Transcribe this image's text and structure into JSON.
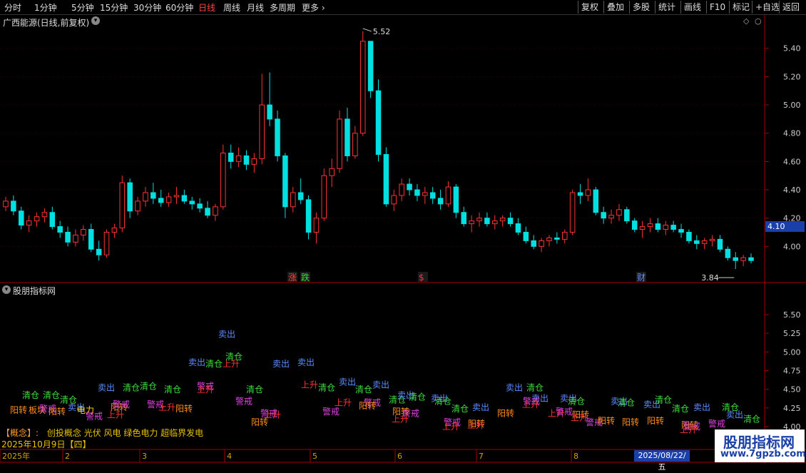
{
  "toolbar": {
    "periods": [
      "分时",
      "1分钟",
      "5分钟",
      "15分钟",
      "30分钟",
      "60分钟",
      "日线",
      "周线",
      "月线",
      "多周期",
      "更多"
    ],
    "buttons": [
      "复权",
      "叠加",
      "多股",
      "统计",
      "画线",
      "F10",
      "标记",
      "+自选",
      "返回"
    ]
  },
  "main_chart": {
    "title": "广西能源(日线,前复权)",
    "high_label": "5.52",
    "low_label": "3.84",
    "current_price": "4.10",
    "event_markers": [
      "涨",
      "跌",
      "$",
      "财"
    ]
  },
  "sub_chart": {
    "title": "股朋指标网",
    "concept_label": "【概念】:",
    "concept_text": "创投概念 光伏 风电 绿色电力 超临界发电",
    "date_text": "2025年10月9日【四】"
  },
  "timeline": {
    "labels": [
      "2025年",
      "2",
      "3",
      "4",
      "5",
      "6",
      "7",
      "8"
    ],
    "cursor_date": "2025/08/22/五"
  },
  "watermark": {
    "title": "股朋指标网",
    "url": "www.7gpzb.com"
  },
  "colors": {
    "up": "#ff3232",
    "down": "#00e0e0",
    "background": "#000000",
    "axis": "#a00000",
    "signal_sell": "#5b8cff",
    "signal_clear": "#3ddc3d",
    "signal_rise": "#ff3232",
    "signal_warn": "#e040e0",
    "signal_turn": "#ff8c1a"
  },
  "chart_data": [
    {
      "type": "candlestick",
      "title": "广西能源(日线,前复权)",
      "ylim": [
        3.8,
        5.55
      ],
      "yticks": [
        "5.40",
        "5.20",
        "5.00",
        "4.80",
        "4.60",
        "4.40",
        "4.20",
        "4.00"
      ],
      "x_labels": [
        "2025年",
        "2",
        "3",
        "4",
        "5",
        "6",
        "7",
        "8"
      ],
      "ohlc": [
        [
          4.28,
          4.35,
          4.25,
          4.32
        ],
        [
          4.32,
          4.36,
          4.22,
          4.25
        ],
        [
          4.25,
          4.28,
          4.12,
          4.15
        ],
        [
          4.15,
          4.22,
          4.1,
          4.18
        ],
        [
          4.18,
          4.24,
          4.14,
          4.21
        ],
        [
          4.21,
          4.27,
          4.17,
          4.24
        ],
        [
          4.24,
          4.28,
          4.12,
          4.14
        ],
        [
          4.14,
          4.18,
          4.06,
          4.1
        ],
        [
          4.1,
          4.14,
          4.0,
          4.03
        ],
        [
          4.03,
          4.12,
          4.0,
          4.08
        ],
        [
          4.08,
          4.15,
          4.04,
          4.12
        ],
        [
          4.12,
          4.16,
          3.96,
          3.98
        ],
        [
          3.98,
          4.04,
          3.9,
          3.94
        ],
        [
          3.94,
          4.12,
          3.92,
          4.1
        ],
        [
          4.1,
          4.16,
          4.06,
          4.13
        ],
        [
          4.13,
          4.5,
          4.1,
          4.45
        ],
        [
          4.45,
          4.48,
          4.2,
          4.25
        ],
        [
          4.25,
          4.35,
          4.22,
          4.32
        ],
        [
          4.32,
          4.42,
          4.28,
          4.38
        ],
        [
          4.38,
          4.45,
          4.3,
          4.34
        ],
        [
          4.34,
          4.4,
          4.28,
          4.31
        ],
        [
          4.31,
          4.38,
          4.28,
          4.35
        ],
        [
          4.35,
          4.42,
          4.3,
          4.36
        ],
        [
          4.36,
          4.4,
          4.3,
          4.32
        ],
        [
          4.32,
          4.35,
          4.26,
          4.3
        ],
        [
          4.3,
          4.34,
          4.24,
          4.27
        ],
        [
          4.27,
          4.32,
          4.2,
          4.22
        ],
        [
          4.22,
          4.3,
          4.18,
          4.28
        ],
        [
          4.28,
          4.72,
          4.26,
          4.66
        ],
        [
          4.66,
          4.72,
          4.55,
          4.6
        ],
        [
          4.6,
          4.7,
          4.56,
          4.64
        ],
        [
          4.64,
          4.68,
          4.54,
          4.58
        ],
        [
          4.58,
          4.66,
          4.52,
          4.62
        ],
        [
          4.62,
          5.22,
          4.58,
          5.0
        ],
        [
          5.0,
          5.23,
          4.85,
          4.9
        ],
        [
          4.9,
          4.96,
          4.6,
          4.64
        ],
        [
          4.64,
          4.66,
          4.2,
          4.28
        ],
        [
          4.28,
          4.42,
          4.24,
          4.38
        ],
        [
          4.38,
          4.48,
          4.3,
          4.33
        ],
        [
          4.33,
          4.36,
          4.05,
          4.1
        ],
        [
          4.1,
          4.24,
          4.02,
          4.2
        ],
        [
          4.2,
          4.55,
          4.18,
          4.5
        ],
        [
          4.5,
          4.62,
          4.42,
          4.55
        ],
        [
          4.55,
          4.96,
          4.52,
          4.9
        ],
        [
          4.9,
          4.98,
          4.6,
          4.64
        ],
        [
          4.64,
          4.85,
          4.62,
          4.8
        ],
        [
          4.8,
          5.52,
          4.78,
          5.45
        ],
        [
          5.45,
          5.42,
          5.05,
          5.1
        ],
        [
          5.1,
          5.18,
          4.6,
          4.65
        ],
        [
          4.65,
          4.7,
          4.28,
          4.3
        ],
        [
          4.3,
          4.4,
          4.25,
          4.36
        ],
        [
          4.36,
          4.48,
          4.32,
          4.44
        ],
        [
          4.44,
          4.48,
          4.36,
          4.4
        ],
        [
          4.4,
          4.44,
          4.32,
          4.36
        ],
        [
          4.36,
          4.42,
          4.3,
          4.38
        ],
        [
          4.38,
          4.42,
          4.3,
          4.34
        ],
        [
          4.34,
          4.4,
          4.26,
          4.3
        ],
        [
          4.3,
          4.46,
          4.28,
          4.42
        ],
        [
          4.42,
          4.44,
          4.2,
          4.24
        ],
        [
          4.24,
          4.28,
          4.14,
          4.16
        ],
        [
          4.16,
          4.22,
          4.1,
          4.18
        ],
        [
          4.18,
          4.24,
          4.14,
          4.2
        ],
        [
          4.2,
          4.24,
          4.14,
          4.16
        ],
        [
          4.16,
          4.22,
          4.12,
          4.18
        ],
        [
          4.18,
          4.22,
          4.14,
          4.2
        ],
        [
          4.2,
          4.24,
          4.14,
          4.16
        ],
        [
          4.16,
          4.2,
          4.08,
          4.1
        ],
        [
          4.1,
          4.14,
          4.02,
          4.04
        ],
        [
          4.04,
          4.08,
          3.98,
          4.0
        ],
        [
          4.0,
          4.06,
          3.96,
          4.04
        ],
        [
          4.04,
          4.08,
          4.0,
          4.06
        ],
        [
          4.06,
          4.1,
          4.02,
          4.05
        ],
        [
          4.05,
          4.12,
          4.02,
          4.1
        ],
        [
          4.1,
          4.4,
          4.08,
          4.38
        ],
        [
          4.38,
          4.44,
          4.3,
          4.36
        ],
        [
          4.36,
          4.48,
          4.32,
          4.4
        ],
        [
          4.4,
          4.42,
          4.22,
          4.24
        ],
        [
          4.24,
          4.28,
          4.16,
          4.2
        ],
        [
          4.2,
          4.26,
          4.16,
          4.22
        ],
        [
          4.22,
          4.3,
          4.18,
          4.26
        ],
        [
          4.26,
          4.28,
          4.16,
          4.18
        ],
        [
          4.18,
          4.2,
          4.1,
          4.12
        ],
        [
          4.12,
          4.18,
          4.06,
          4.14
        ],
        [
          4.14,
          4.2,
          4.1,
          4.16
        ],
        [
          4.16,
          4.2,
          4.1,
          4.12
        ],
        [
          4.12,
          4.18,
          4.08,
          4.15
        ],
        [
          4.15,
          4.18,
          4.1,
          4.12
        ],
        [
          4.12,
          4.16,
          4.06,
          4.1
        ],
        [
          4.1,
          4.12,
          4.02,
          4.04
        ],
        [
          4.04,
          4.08,
          3.98,
          4.02
        ],
        [
          4.02,
          4.06,
          3.98,
          4.04
        ],
        [
          4.04,
          4.08,
          4.0,
          4.05
        ],
        [
          4.05,
          4.08,
          3.96,
          3.98
        ],
        [
          3.98,
          4.0,
          3.9,
          3.92
        ],
        [
          3.92,
          3.96,
          3.84,
          3.9
        ],
        [
          3.9,
          3.94,
          3.86,
          3.92
        ],
        [
          3.92,
          3.95,
          3.88,
          3.9
        ]
      ]
    },
    {
      "type": "scatter",
      "title": "股朋指标网",
      "ylim": [
        4.0,
        5.7
      ],
      "yticks": [
        "5.50",
        "5.25",
        "5.00",
        "4.75",
        "4.50",
        "4.25",
        "4.00"
      ],
      "signals": [
        {
          "x": 31,
          "y": 4.38,
          "label": "清仓"
        },
        {
          "x": 60,
          "y": 4.38,
          "label": "清仓"
        },
        {
          "x": 84,
          "y": 4.32,
          "label": "清仓"
        },
        {
          "x": 14,
          "y": 4.18,
          "label": "阳转"
        },
        {
          "x": 40,
          "y": 4.18,
          "label": "板块"
        },
        {
          "x": 55,
          "y": 4.2,
          "label": "警戒"
        },
        {
          "x": 68,
          "y": 4.16,
          "label": "阳转"
        },
        {
          "x": 95,
          "y": 4.22,
          "label": "卖出"
        },
        {
          "x": 108,
          "y": 4.18,
          "label": "电力"
        },
        {
          "x": 137,
          "y": 4.48,
          "label": "卖出"
        },
        {
          "x": 172,
          "y": 4.48,
          "label": "清仓"
        },
        {
          "x": 196,
          "y": 4.5,
          "label": "清仓"
        },
        {
          "x": 230,
          "y": 4.46,
          "label": "清仓"
        },
        {
          "x": 155,
          "y": 4.22,
          "label": "阳转"
        },
        {
          "x": 158,
          "y": 4.26,
          "label": "警戒"
        },
        {
          "x": 206,
          "y": 4.26,
          "label": "警戒"
        },
        {
          "x": 222,
          "y": 4.22,
          "label": "上升"
        },
        {
          "x": 246,
          "y": 4.2,
          "label": "阳转"
        },
        {
          "x": 150,
          "y": 4.12,
          "label": "上升"
        },
        {
          "x": 120,
          "y": 4.1,
          "label": "警戒"
        },
        {
          "x": 264,
          "y": 4.82,
          "label": "卖出"
        },
        {
          "x": 288,
          "y": 4.8,
          "label": "清仓"
        },
        {
          "x": 312,
          "y": 4.8,
          "label": "上升"
        },
        {
          "x": 316,
          "y": 4.9,
          "label": "清仓"
        },
        {
          "x": 306,
          "y": 5.2,
          "label": "卖出"
        },
        {
          "x": 276,
          "y": 4.5,
          "label": "警戒"
        },
        {
          "x": 276,
          "y": 4.46,
          "label": "上升"
        },
        {
          "x": 345,
          "y": 4.46,
          "label": "清仓"
        },
        {
          "x": 330,
          "y": 4.3,
          "label": "警戒"
        },
        {
          "x": 365,
          "y": 4.14,
          "label": "警戒"
        },
        {
          "x": 370,
          "y": 4.12,
          "label": "上升"
        },
        {
          "x": 352,
          "y": 4.02,
          "label": "阳转"
        },
        {
          "x": 382,
          "y": 4.8,
          "label": "卖出"
        },
        {
          "x": 417,
          "y": 4.82,
          "label": "卖出"
        },
        {
          "x": 422,
          "y": 4.52,
          "label": "上升"
        },
        {
          "x": 446,
          "y": 4.48,
          "label": "清仓"
        },
        {
          "x": 475,
          "y": 4.56,
          "label": "卖出"
        },
        {
          "x": 498,
          "y": 4.46,
          "label": "清仓"
        },
        {
          "x": 522,
          "y": 4.52,
          "label": "卖出"
        },
        {
          "x": 452,
          "y": 4.16,
          "label": "警戒"
        },
        {
          "x": 469,
          "y": 4.28,
          "label": "上升"
        },
        {
          "x": 510,
          "y": 4.28,
          "label": "警戒"
        },
        {
          "x": 503,
          "y": 4.24,
          "label": "阳转"
        },
        {
          "x": 545,
          "y": 4.32,
          "label": "清仓"
        },
        {
          "x": 557,
          "y": 4.38,
          "label": "卖出"
        },
        {
          "x": 573,
          "y": 4.36,
          "label": "清仓"
        },
        {
          "x": 550,
          "y": 4.16,
          "label": "阳转"
        },
        {
          "x": 564,
          "y": 4.14,
          "label": "警戒"
        },
        {
          "x": 549,
          "y": 4.06,
          "label": "上升"
        },
        {
          "x": 604,
          "y": 4.34,
          "label": "卖出"
        },
        {
          "x": 609,
          "y": 4.3,
          "label": "清仓"
        },
        {
          "x": 633,
          "y": 4.2,
          "label": "清仓"
        },
        {
          "x": 662,
          "y": 4.22,
          "label": "卖出"
        },
        {
          "x": 622,
          "y": 4.02,
          "label": "警戒"
        },
        {
          "x": 656,
          "y": 4.0,
          "label": "阳转"
        },
        {
          "x": 655,
          "y": 3.98,
          "label": "上升"
        },
        {
          "x": 697,
          "y": 4.14,
          "label": "阳转"
        },
        {
          "x": 620,
          "y": 3.96,
          "label": "上升"
        },
        {
          "x": 709,
          "y": 4.48,
          "label": "卖出"
        },
        {
          "x": 738,
          "y": 4.48,
          "label": "清仓"
        },
        {
          "x": 733,
          "y": 4.3,
          "label": "警戒"
        },
        {
          "x": 745,
          "y": 4.34,
          "label": "卖出"
        },
        {
          "x": 732,
          "y": 4.26,
          "label": "上升"
        },
        {
          "x": 768,
          "y": 4.14,
          "label": "上升"
        },
        {
          "x": 779,
          "y": 4.16,
          "label": "警戒"
        },
        {
          "x": 785,
          "y": 4.34,
          "label": "卖出"
        },
        {
          "x": 796,
          "y": 4.3,
          "label": "清仓"
        },
        {
          "x": 802,
          "y": 4.12,
          "label": "阳转"
        },
        {
          "x": 800,
          "y": 4.08,
          "label": "上升"
        },
        {
          "x": 821,
          "y": 4.02,
          "label": "警戒"
        },
        {
          "x": 838,
          "y": 4.04,
          "label": "阳转"
        },
        {
          "x": 856,
          "y": 4.3,
          "label": "卖出"
        },
        {
          "x": 866,
          "y": 4.28,
          "label": "清仓"
        },
        {
          "x": 872,
          "y": 4.02,
          "label": "阳转"
        },
        {
          "x": 902,
          "y": 4.26,
          "label": "卖出"
        },
        {
          "x": 918,
          "y": 4.32,
          "label": "清仓"
        },
        {
          "x": 907,
          "y": 4.04,
          "label": "阳转"
        },
        {
          "x": 942,
          "y": 4.2,
          "label": "清仓"
        },
        {
          "x": 972,
          "y": 4.22,
          "label": "卖出"
        },
        {
          "x": 1012,
          "y": 4.22,
          "label": "清仓"
        },
        {
          "x": 955,
          "y": 3.98,
          "label": "阳转"
        },
        {
          "x": 958,
          "y": 3.96,
          "label": "警戒"
        },
        {
          "x": 993,
          "y": 4.0,
          "label": "警戒"
        },
        {
          "x": 1018,
          "y": 4.12,
          "label": "卖出"
        },
        {
          "x": 1042,
          "y": 4.06,
          "label": "清仓"
        },
        {
          "x": 953,
          "y": 3.92,
          "label": "上升"
        }
      ]
    }
  ]
}
